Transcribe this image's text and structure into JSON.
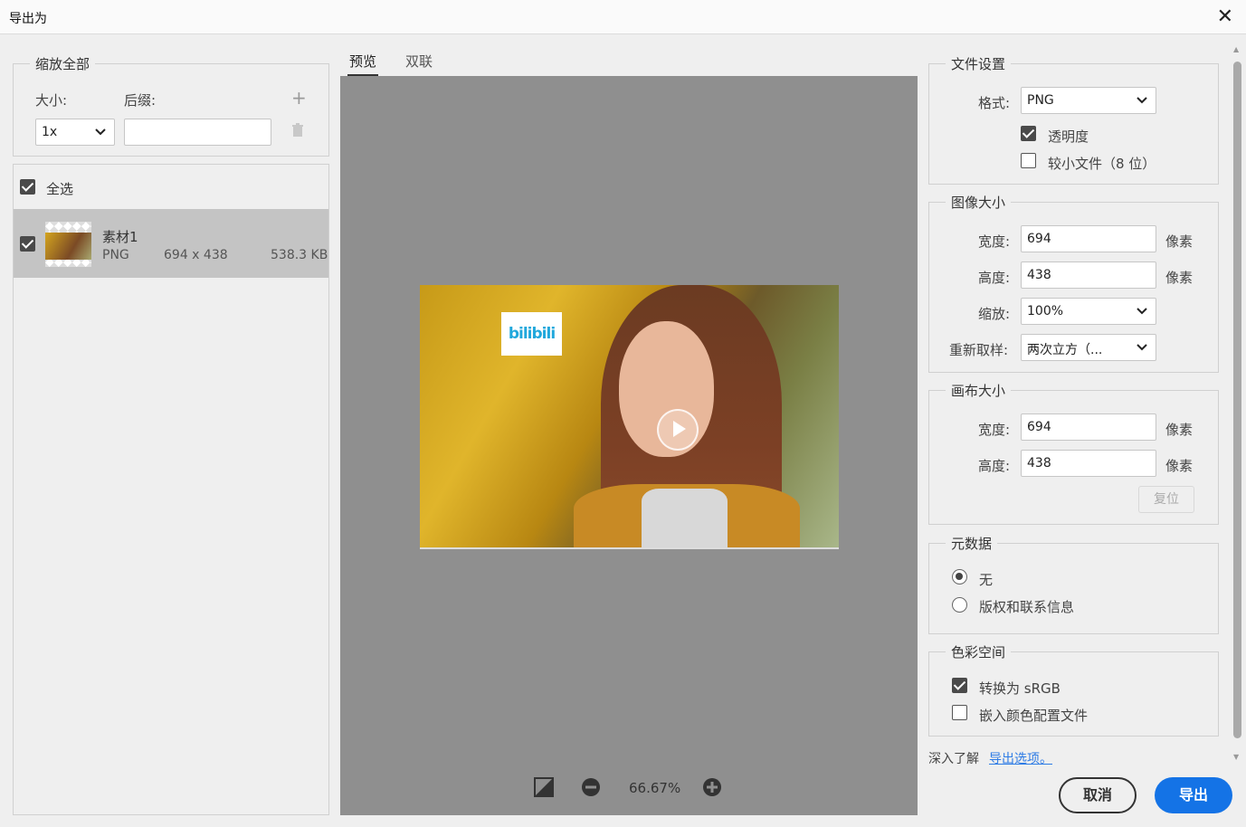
{
  "window": {
    "title": "导出为",
    "close_icon": "close-icon"
  },
  "left": {
    "scale_group_label": "缩放全部",
    "size_label": "大小:",
    "suffix_label": "后缀:",
    "size_value": "1x",
    "suffix_value": "",
    "select_all_label": "全选",
    "select_all_checked": true,
    "asset": {
      "name": "素材1",
      "format": "PNG",
      "dimensions": "694 x 438",
      "filesize": "538.3 KB",
      "checked": true
    }
  },
  "center": {
    "tabs": [
      {
        "label": "预览",
        "active": true
      },
      {
        "label": "双联",
        "active": false
      }
    ],
    "logo_text": "bilibili",
    "zoom_level": "66.67%"
  },
  "right": {
    "file_settings": {
      "label": "文件设置",
      "format_label": "格式:",
      "format_value": "PNG",
      "transparency_label": "透明度",
      "transparency_checked": true,
      "smaller_file_label": "较小文件（8 位）",
      "smaller_file_checked": false
    },
    "image_size": {
      "label": "图像大小",
      "width_label": "宽度:",
      "width_value": "694",
      "height_label": "高度:",
      "height_value": "438",
      "unit": "像素",
      "scale_label": "缩放:",
      "scale_value": "100%",
      "resample_label": "重新取样:",
      "resample_value": "两次立方（..."
    },
    "canvas_size": {
      "label": "画布大小",
      "width_label": "宽度:",
      "width_value": "694",
      "height_label": "高度:",
      "height_value": "438",
      "unit": "像素",
      "reset_label": "复位"
    },
    "metadata": {
      "label": "元数据",
      "none_label": "无",
      "copyright_label": "版权和联系信息",
      "selected": "无"
    },
    "color_space": {
      "label": "色彩空间",
      "convert_label": "转换为 sRGB",
      "convert_checked": true,
      "embed_label": "嵌入颜色配置文件",
      "embed_checked": false
    },
    "learn_more_prefix": "深入了解",
    "learn_more_link": "导出选项。"
  },
  "footer": {
    "cancel_label": "取消",
    "export_label": "导出"
  },
  "colors": {
    "accent": "#1473e6",
    "preview_bg": "#8f8f8f"
  }
}
